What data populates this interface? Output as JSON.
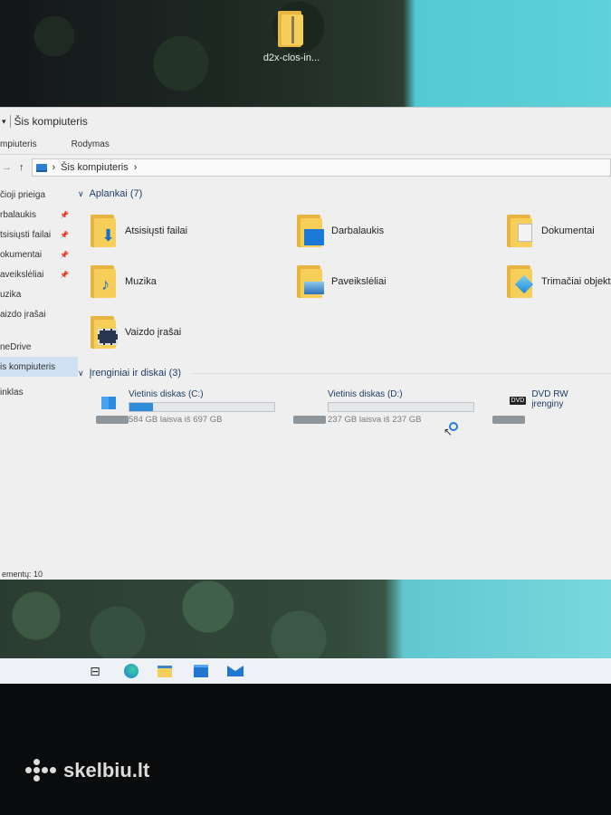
{
  "desktop": {
    "icon_label": "d2x-clos-in..."
  },
  "window": {
    "title": "Šis kompiuteris",
    "ribbon_tabs": [
      "mpiuteris",
      "Rodymas"
    ],
    "address": "Šis kompiuteris",
    "status": "ementų: 10"
  },
  "nav": {
    "items": [
      {
        "label": "čioji prieiga",
        "pinned": false
      },
      {
        "label": "rbalaukis",
        "pinned": true
      },
      {
        "label": "tsisiųsti failai",
        "pinned": true
      },
      {
        "label": "okumentai",
        "pinned": true
      },
      {
        "label": "aveikslėliai",
        "pinned": true
      },
      {
        "label": "uzika",
        "pinned": false
      },
      {
        "label": "aizdo įrašai",
        "pinned": false
      },
      {
        "label": "neDrive",
        "pinned": false
      },
      {
        "label": "is kompiuteris",
        "pinned": false,
        "selected": true
      },
      {
        "label": "inklas",
        "pinned": false
      }
    ]
  },
  "folders_group": {
    "title": "Aplankai (7)",
    "items": [
      {
        "name": "Atsisiųsti failai",
        "icon": "download-arrow-icon"
      },
      {
        "name": "Darbalaukis",
        "icon": "desktop-icon"
      },
      {
        "name": "Dokumentai",
        "icon": "document-icon"
      },
      {
        "name": "Muzika",
        "icon": "music-note-icon"
      },
      {
        "name": "Paveikslėliai",
        "icon": "picture-icon"
      },
      {
        "name": "Trimačiai objekt",
        "icon": "cube-icon"
      },
      {
        "name": "Vaizdo įrašai",
        "icon": "film-icon"
      }
    ]
  },
  "drives_group": {
    "title": "Įrenginiai ir diskai (3)",
    "items": [
      {
        "name": "Vietinis diskas (C:)",
        "space": "584 GB laisva iš 697 GB",
        "used_fraction": 0.16
      },
      {
        "name": "Vietinis diskas (D:)",
        "space": "237 GB laisva iš 237 GB",
        "used_fraction": 0.0
      },
      {
        "name": "DVD RW įrenginy",
        "space": "",
        "tag": "DVD"
      }
    ]
  },
  "watermark": "skelbiu.lt",
  "colors": {
    "folder": "#f5cf5a",
    "accent": "#2f8ad9",
    "window_bg": "#efefef"
  }
}
